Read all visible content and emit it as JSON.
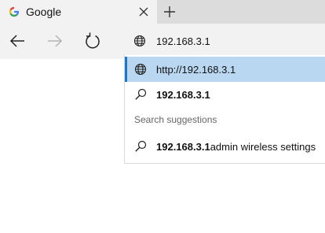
{
  "tab": {
    "title": "Google",
    "favicon_icon": "google-g-icon",
    "close_icon": "close-icon"
  },
  "toolbar": {
    "new_tab_icon": "plus-icon",
    "back_icon": "arrow-left-icon",
    "forward_icon": "arrow-right-icon",
    "refresh_icon": "refresh-icon"
  },
  "omnibox": {
    "value": "192.168.3.1",
    "icon": "globe-icon"
  },
  "suggestions": {
    "items": [
      {
        "text": "http://192.168.3.1",
        "icon": "globe-icon",
        "selected": true
      },
      {
        "text": "192.168.3.1",
        "icon": "search-icon"
      }
    ],
    "section_label": "Search suggestions",
    "search_items": [
      {
        "query": "192.168.3.1",
        "completion": "admin wireless settings",
        "icon": "search-icon"
      }
    ]
  },
  "colors": {
    "selected_bg": "#b9d7f0",
    "accent": "#1979ca",
    "tab_strip": "#dcdcdc",
    "toolbar": "#f2f2f2"
  }
}
